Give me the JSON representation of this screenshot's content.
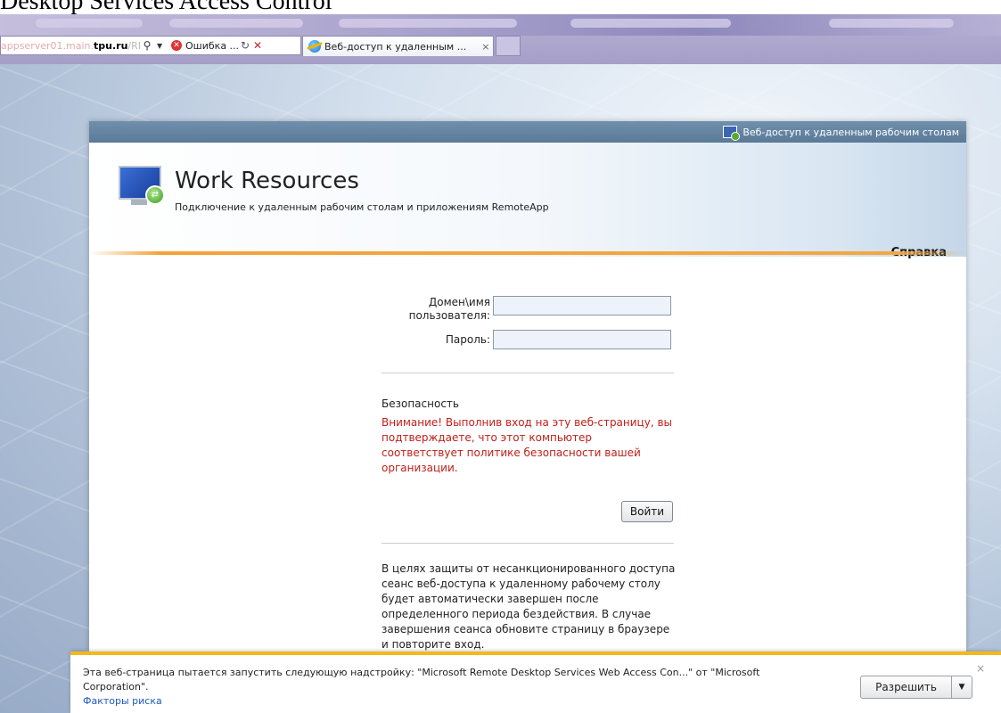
{
  "document_caption": "Desktop Services Access Control",
  "browser": {
    "address": {
      "prefix": "appserver01.main.",
      "domain": "tpu.ru",
      "suffix": "/RI",
      "search_icon": "magnifier-icon",
      "dropdown_icon": "chevron-down-icon",
      "error_tab_title": "Ошибка ...",
      "refresh_icon": "refresh-icon",
      "stop_icon": "close-icon"
    },
    "active_tab": {
      "title": "Веб-доступ к удаленным ...",
      "close": "×"
    }
  },
  "page": {
    "topbar_label": "Веб-доступ к удаленным рабочим столам",
    "app_title": "Work Resources",
    "app_subtitle": "Подключение к удаленным рабочим столам и приложениям RemoteApp",
    "help_link": "Справка",
    "form": {
      "username_label": "Домен\\имя пользователя:",
      "username_value": "",
      "password_label": "Пароль:",
      "password_value": "",
      "security_title": "Безопасность",
      "security_warning": "Внимание! Выполнив вход на эту веб-страницу, вы подтверждаете, что этот компьютер соответствует политике безопасности вашей организации.",
      "login_button": "Войти",
      "timeout_text": "В целях защиты от несанкционированного доступа сеанс веб-доступа к удаленному рабочему столу будет автоматически завершен после определенного периода бездействия. В случае завершения сеанса обновите страницу в браузере и повторите вход."
    }
  },
  "notification": {
    "message": "Эта веб-страница пытается запустить следующую надстройку: \"Microsoft Remote Desktop Services Web Access Con...\" от \"Microsoft Corporation\".",
    "risk_link": "Факторы риска",
    "allow_button": "Разрешить",
    "allow_dropdown": "▼",
    "close": "×"
  },
  "colors": {
    "accent_orange": "#f4a23a",
    "warning_red": "#c0201a",
    "notification_border": "#f2b81e",
    "link_blue": "#1d5ab8"
  }
}
